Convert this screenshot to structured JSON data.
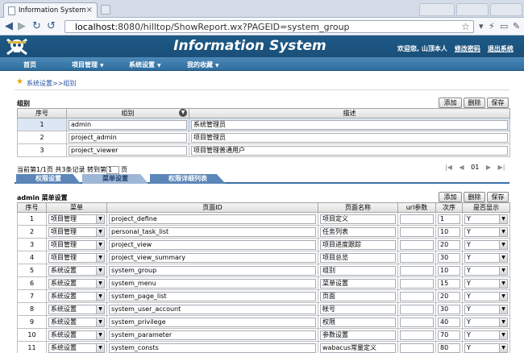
{
  "browser": {
    "tab_title": "Information System",
    "tab_close": "×",
    "url_host": "localhost",
    "url_rest": ":8080/hilltop/ShowReport.wx?PAGEID=system_group"
  },
  "header": {
    "title": "Information System",
    "welcome": "欢迎您, 山顶本人",
    "change_password": "修改密码",
    "logout": "退出系统"
  },
  "menu": {
    "items": [
      "首页",
      "项目管理",
      "系统设置",
      "我的收藏"
    ]
  },
  "breadcrumb": {
    "parent": "系统设置",
    "separator": ">>",
    "current": "组别"
  },
  "group_section": {
    "title": "组别",
    "buttons": {
      "add": "添加",
      "delete": "删除",
      "save": "保存"
    },
    "columns": {
      "index": "序号",
      "group": "组别",
      "desc": "描述"
    },
    "rows": [
      {
        "index": "1",
        "group": "admin",
        "desc": "系统管理员"
      },
      {
        "index": "2",
        "group": "project_admin",
        "desc": "项目管理员"
      },
      {
        "index": "3",
        "group": "project_viewer",
        "desc": "项目管理普通用户"
      }
    ]
  },
  "pager": {
    "text": "当前第1/1页 共3条记录 转到第",
    "value": "1",
    "unit": "页",
    "current_page": "01"
  },
  "subtabs": [
    "权限设置",
    "菜单设置",
    "权限详细列表"
  ],
  "menu_section": {
    "title": "admin 菜单设置",
    "buttons": {
      "add": "添加",
      "delete": "删除",
      "save": "保存"
    },
    "columns": {
      "index": "序号",
      "menu": "菜单",
      "page_id": "页面ID",
      "page_name": "页面名称",
      "url_params": "url参数",
      "order": "次序",
      "visible": "是否显示"
    },
    "rows": [
      {
        "index": "1",
        "menu": "项目管理",
        "page_id": "project_define",
        "page_name": "项目定义",
        "url_params": "",
        "order": "1",
        "visible": "Y"
      },
      {
        "index": "2",
        "menu": "项目管理",
        "page_id": "personal_task_list",
        "page_name": "任务列表",
        "url_params": "",
        "order": "10",
        "visible": "Y"
      },
      {
        "index": "3",
        "menu": "项目管理",
        "page_id": "project_view",
        "page_name": "项目进度跟踪",
        "url_params": "",
        "order": "20",
        "visible": "Y"
      },
      {
        "index": "4",
        "menu": "项目管理",
        "page_id": "project_view_summary",
        "page_name": "项目总览",
        "url_params": "",
        "order": "30",
        "visible": "Y"
      },
      {
        "index": "5",
        "menu": "系统设置",
        "page_id": "system_group",
        "page_name": "组别",
        "url_params": "",
        "order": "10",
        "visible": "Y"
      },
      {
        "index": "6",
        "menu": "系统设置",
        "page_id": "system_menu",
        "page_name": "菜单设置",
        "url_params": "",
        "order": "15",
        "visible": "Y"
      },
      {
        "index": "7",
        "menu": "系统设置",
        "page_id": "system_page_list",
        "page_name": "页面",
        "url_params": "",
        "order": "20",
        "visible": "Y"
      },
      {
        "index": "8",
        "menu": "系统设置",
        "page_id": "system_user_account",
        "page_name": "帐号",
        "url_params": "",
        "order": "30",
        "visible": "Y"
      },
      {
        "index": "9",
        "menu": "系统设置",
        "page_id": "system_privilege",
        "page_name": "权限",
        "url_params": "",
        "order": "40",
        "visible": "Y"
      },
      {
        "index": "10",
        "menu": "系统设置",
        "page_id": "system_parameter",
        "page_name": "参数设置",
        "url_params": "",
        "order": "70",
        "visible": "Y"
      },
      {
        "index": "11",
        "menu": "系统设置",
        "page_id": "system_consts",
        "page_name": "wabacus常量定义",
        "url_params": "",
        "order": "80",
        "visible": "Y"
      }
    ]
  }
}
